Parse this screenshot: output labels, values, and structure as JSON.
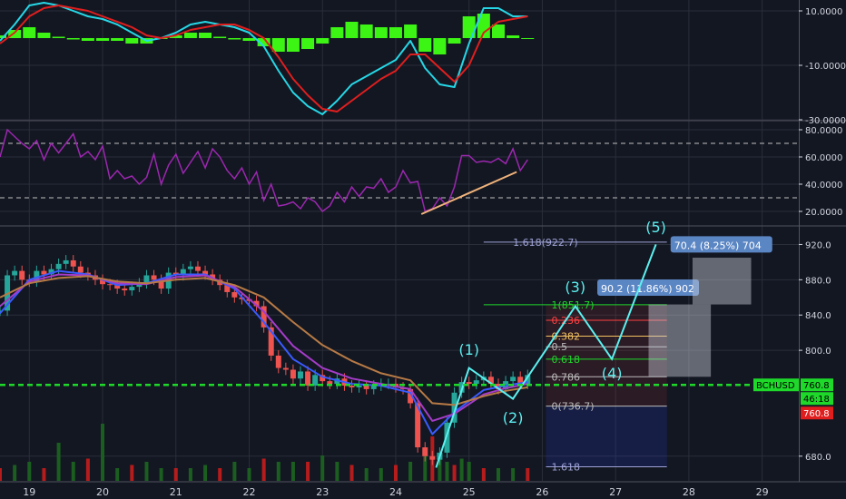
{
  "symbol_tag": "BCHUSD",
  "price_tags": {
    "last": "760.8",
    "countdown": "46:18",
    "close": "760.8"
  },
  "colors": {
    "bg": "#131722",
    "grid": "#2a2e39",
    "axis_text": "#d1d4dc",
    "up": "#26a69a",
    "down": "#ef5350",
    "macd": "#26d7e6",
    "signal": "#e01e1e",
    "hist": "#3cf514",
    "rsi": "#9c27b0",
    "trend": "#f0b27a",
    "green_line": "#1ed82a",
    "wave": "#5cf0f0",
    "fib_text": "#9fa3d6",
    "fib_green": "#1ed82a",
    "fib_red": "#ff4040",
    "fib_orange": "#f2c260",
    "fib_gray": "#bbbbbb"
  },
  "chart_data": [
    {
      "type": "line",
      "name": "macd_pane",
      "ylim": [
        -30,
        14
      ],
      "y_ticks": [
        10,
        -10,
        -30
      ],
      "y_tick_labels": [
        "10.0000",
        "-10.0000",
        "-30.0000"
      ],
      "series": [
        {
          "role": "macd",
          "x": [
            18.6,
            18.8,
            19.0,
            19.2,
            19.4,
            19.6,
            19.8,
            20.0,
            20.2,
            20.4,
            20.6,
            20.8,
            21.0,
            21.2,
            21.4,
            21.6,
            21.8,
            22.0,
            22.2,
            22.4,
            22.6,
            22.8,
            23.0,
            23.2,
            23.4,
            23.6,
            23.8,
            24.0,
            24.2,
            24.4,
            24.6,
            24.8,
            25.0,
            25.2,
            25.4,
            25.6,
            25.8
          ],
          "values": [
            -1,
            5,
            12,
            13,
            12,
            10,
            8,
            7,
            5,
            2,
            -1,
            0,
            2,
            5,
            6,
            5,
            4,
            2,
            -3,
            -12,
            -20,
            -25,
            -28,
            -23,
            -17,
            -14,
            -11,
            -8,
            -1,
            -11,
            -17,
            -18,
            -2,
            11,
            11,
            8,
            8
          ]
        },
        {
          "role": "signal",
          "x": [
            18.6,
            18.8,
            19.0,
            19.2,
            19.4,
            19.6,
            19.8,
            20.0,
            20.2,
            20.4,
            20.6,
            20.8,
            21.0,
            21.2,
            21.4,
            21.6,
            21.8,
            22.0,
            22.2,
            22.4,
            22.6,
            22.8,
            23.0,
            23.2,
            23.4,
            23.6,
            23.8,
            24.0,
            24.2,
            24.4,
            24.6,
            24.8,
            25.0,
            25.2,
            25.4,
            25.6,
            25.8
          ],
          "values": [
            -2,
            2,
            8,
            11,
            12,
            11,
            10,
            8,
            6,
            4,
            1,
            0,
            1,
            3,
            4,
            5,
            5,
            3,
            0,
            -7,
            -15,
            -21,
            -26,
            -27,
            -23,
            -19,
            -15,
            -12,
            -6,
            -6,
            -11,
            -16,
            -10,
            2,
            6,
            7,
            8
          ]
        }
      ],
      "histogram": {
        "x": [
          18.6,
          18.8,
          19.0,
          19.2,
          19.4,
          19.6,
          19.8,
          20.0,
          20.2,
          20.4,
          20.6,
          20.8,
          21.0,
          21.2,
          21.4,
          21.6,
          21.8,
          22.0,
          22.2,
          22.4,
          22.6,
          22.8,
          23.0,
          23.2,
          23.4,
          23.6,
          23.8,
          24.0,
          24.2,
          24.4,
          24.6,
          24.8,
          25.0,
          25.2,
          25.4,
          25.6,
          25.8
        ],
        "values": [
          1,
          3,
          4,
          2,
          0.5,
          -0.5,
          -1,
          -1,
          -1,
          -2,
          -2,
          0,
          1,
          2,
          2,
          0.5,
          -0.5,
          -1,
          -3,
          -5,
          -5,
          -4,
          -2,
          4,
          6,
          5,
          4,
          4,
          5,
          -5,
          -6,
          -2,
          8,
          9,
          5,
          1,
          0
        ]
      }
    },
    {
      "type": "line",
      "name": "rsi_pane",
      "ylim": [
        10,
        86
      ],
      "y_ticks": [
        80,
        60,
        40,
        20
      ],
      "y_tick_labels": [
        "80.0000",
        "60.0000",
        "40.0000",
        "20.0000"
      ],
      "guides": [
        70,
        30
      ],
      "series": [
        {
          "role": "rsi",
          "x": [
            18.6,
            18.7,
            18.8,
            18.9,
            19.0,
            19.1,
            19.2,
            19.3,
            19.4,
            19.5,
            19.6,
            19.7,
            19.8,
            19.9,
            20.0,
            20.1,
            20.2,
            20.3,
            20.4,
            20.5,
            20.6,
            20.7,
            20.8,
            20.9,
            21.0,
            21.1,
            21.2,
            21.3,
            21.4,
            21.5,
            21.6,
            21.7,
            21.8,
            21.9,
            22.0,
            22.1,
            22.2,
            22.3,
            22.4,
            22.5,
            22.6,
            22.7,
            22.8,
            22.9,
            23.0,
            23.1,
            23.2,
            23.3,
            23.4,
            23.5,
            23.6,
            23.7,
            23.8,
            23.9,
            24.0,
            24.1,
            24.2,
            24.3,
            24.4,
            24.5,
            24.6,
            24.7,
            24.8,
            24.9,
            25.0,
            25.1,
            25.2,
            25.3,
            25.4,
            25.5,
            25.6,
            25.7,
            25.8
          ],
          "values": [
            60,
            80,
            75,
            70,
            66,
            72,
            58,
            70,
            63,
            70,
            77,
            60,
            64,
            58,
            68,
            44,
            50,
            44,
            46,
            40,
            45,
            62,
            40,
            54,
            62,
            48,
            56,
            64,
            52,
            66,
            60,
            50,
            44,
            52,
            40,
            49,
            28,
            40,
            24,
            25,
            27,
            22,
            30,
            27,
            20,
            24,
            34,
            27,
            38,
            31,
            38,
            37,
            44,
            34,
            38,
            50,
            41,
            42,
            20,
            22,
            30,
            24,
            38,
            61,
            61,
            56,
            57,
            56,
            59,
            55,
            66,
            50,
            58
          ]
        },
        {
          "role": "trendline",
          "x": [
            24.35,
            25.65
          ],
          "values": [
            18,
            49
          ]
        }
      ]
    },
    {
      "type": "candlestick",
      "name": "price_pane",
      "x_ticks": [
        19,
        20,
        21,
        22,
        23,
        24,
        25,
        26,
        27,
        28,
        29
      ],
      "x_tick_labels": [
        "19",
        "20",
        "21",
        "22",
        "23",
        "24",
        "25",
        "26",
        "27",
        "28",
        "29"
      ],
      "ylim": [
        652,
        940
      ],
      "y_ticks": [
        920,
        880,
        840,
        800,
        680
      ],
      "y_tick_labels": [
        "920.0",
        "880.0",
        "840.0",
        "800.0",
        "680.0"
      ],
      "current_price": 760.8,
      "close": {
        "x": [
          18.6,
          18.7,
          18.8,
          18.9,
          19.0,
          19.1,
          19.2,
          19.3,
          19.4,
          19.5,
          19.6,
          19.7,
          19.8,
          19.9,
          20.0,
          20.1,
          20.2,
          20.3,
          20.4,
          20.5,
          20.6,
          20.7,
          20.8,
          20.9,
          21.0,
          21.1,
          21.2,
          21.3,
          21.4,
          21.5,
          21.6,
          21.7,
          21.8,
          21.9,
          22.0,
          22.1,
          22.2,
          22.3,
          22.4,
          22.5,
          22.6,
          22.7,
          22.8,
          22.9,
          23.0,
          23.1,
          23.2,
          23.3,
          23.4,
          23.5,
          23.6,
          23.7,
          23.8,
          23.9,
          24.0,
          24.1,
          24.2,
          24.3,
          24.4,
          24.5,
          24.6,
          24.7,
          24.8,
          24.9,
          25.0,
          25.1,
          25.2,
          25.3,
          25.4,
          25.5,
          25.6,
          25.7,
          25.8
        ],
        "values": [
          845,
          885,
          890,
          880,
          878,
          890,
          886,
          892,
          898,
          902,
          895,
          888,
          885,
          880,
          875,
          874,
          870,
          868,
          872,
          876,
          885,
          880,
          870,
          888,
          885,
          892,
          895,
          890,
          886,
          880,
          874,
          866,
          860,
          858,
          856,
          850,
          826,
          794,
          780,
          778,
          768,
          776,
          760,
          772,
          765,
          762,
          768,
          760,
          758,
          760,
          756,
          760,
          762,
          762,
          758,
          756,
          740,
          690,
          680,
          676,
          684,
          718,
          752,
          764,
          762,
          766,
          770,
          762,
          756,
          765,
          770,
          762,
          772
        ]
      },
      "moving_averages": [
        {
          "role": "ma_fast",
          "color": "#3a5bff",
          "x": [
            18.6,
            19.0,
            19.4,
            19.8,
            20.2,
            20.6,
            21.0,
            21.4,
            21.8,
            22.2,
            22.6,
            23.0,
            23.4,
            23.8,
            24.2,
            24.5,
            24.8,
            25.2,
            25.5,
            25.8
          ],
          "values": [
            842,
            880,
            890,
            886,
            874,
            876,
            886,
            886,
            870,
            832,
            790,
            770,
            762,
            760,
            752,
            705,
            730,
            755,
            760,
            764
          ]
        },
        {
          "role": "ma_mid",
          "color": "#a43cc8",
          "x": [
            18.6,
            19.0,
            19.4,
            19.8,
            20.2,
            20.6,
            21.0,
            21.4,
            21.8,
            22.2,
            22.6,
            23.0,
            23.4,
            23.8,
            24.2,
            24.5,
            24.8,
            25.2,
            25.5,
            25.8
          ],
          "values": [
            850,
            878,
            886,
            885,
            876,
            875,
            883,
            885,
            872,
            844,
            805,
            780,
            768,
            762,
            756,
            720,
            728,
            750,
            757,
            762
          ]
        },
        {
          "role": "ma_slow",
          "color": "#b77a45",
          "x": [
            18.6,
            19.0,
            19.4,
            19.8,
            20.2,
            20.6,
            21.0,
            21.4,
            21.8,
            22.2,
            22.6,
            23.0,
            23.4,
            23.8,
            24.2,
            24.5,
            24.8,
            25.2,
            25.5,
            25.8
          ],
          "values": [
            860,
            876,
            882,
            884,
            878,
            876,
            880,
            882,
            874,
            860,
            832,
            806,
            788,
            774,
            766,
            740,
            738,
            748,
            754,
            758
          ]
        }
      ],
      "volume": {
        "x": [
          18.6,
          18.8,
          19.0,
          19.2,
          19.4,
          19.6,
          19.8,
          20.0,
          20.2,
          20.4,
          20.6,
          20.8,
          21.0,
          21.2,
          21.4,
          21.6,
          21.8,
          22.0,
          22.2,
          22.4,
          22.6,
          22.8,
          23.0,
          23.2,
          23.4,
          23.6,
          23.8,
          24.0,
          24.2,
          24.4,
          24.5,
          24.6,
          24.7,
          24.8,
          24.9,
          25.0,
          25.2,
          25.4,
          25.6,
          25.8
        ],
        "values": [
          0.2,
          0.25,
          0.3,
          0.2,
          0.6,
          0.3,
          0.35,
          0.9,
          0.2,
          0.25,
          0.3,
          0.2,
          0.2,
          0.2,
          0.25,
          0.2,
          0.3,
          0.2,
          0.35,
          0.3,
          0.3,
          0.3,
          0.4,
          0.3,
          0.25,
          0.2,
          0.2,
          0.25,
          0.3,
          0.5,
          0.7,
          0.35,
          0.3,
          0.25,
          0.35,
          0.3,
          0.2,
          0.2,
          0.2,
          0.2
        ]
      },
      "fibonacci": [
        {
          "level": "1.618",
          "label": "1.618(922.7)",
          "price": 922.7,
          "color": "#9fa3d6"
        },
        {
          "level": "1",
          "label": "1(851.7)",
          "price": 851.7,
          "color": "#1ed82a"
        },
        {
          "level": "0.236",
          "label": "0.236",
          "price": 834,
          "color": "#ff4040"
        },
        {
          "level": "0.382",
          "label": "0.382",
          "price": 816,
          "color": "#f2c260"
        },
        {
          "level": "0.5",
          "label": "0.5",
          "price": 804,
          "color": "#bbbbbb"
        },
        {
          "level": "0.618",
          "label": "0.618",
          "price": 790,
          "color": "#1ed82a"
        },
        {
          "level": "0.786",
          "label": "0.786",
          "price": 770,
          "color": "#bbbbbb"
        },
        {
          "level": "0",
          "label": "0(736.7)",
          "price": 736.7,
          "color": "#bbbbbb"
        },
        {
          "level": "1.618",
          "label": "1.618",
          "price": 668,
          "color": "#9fa3d6"
        }
      ],
      "wave_path": {
        "x": [
          24.55,
          25.0,
          25.6,
          26.45,
          26.95,
          27.55
        ],
        "values": [
          667,
          780,
          745,
          850,
          790,
          920
        ]
      },
      "wave_labels": [
        {
          "text": "(1)",
          "x": 25.0,
          "price": 795
        },
        {
          "text": "(2)",
          "x": 25.6,
          "price": 718
        },
        {
          "text": "(3)",
          "x": 26.45,
          "price": 866
        },
        {
          "text": "(4)",
          "x": 26.95,
          "price": 768
        },
        {
          "text": "(5)",
          "x": 27.55,
          "price": 934
        }
      ],
      "projection_boxes": [
        {
          "label": "90.2 (11.86%) 902",
          "x0": 27.45,
          "x1": 28.3,
          "y0": 770,
          "y1": 852
        },
        {
          "label": "70.4 (8.25%) 704",
          "x0": 28.05,
          "x1": 28.85,
          "y0": 852,
          "y1": 905
        }
      ]
    }
  ]
}
